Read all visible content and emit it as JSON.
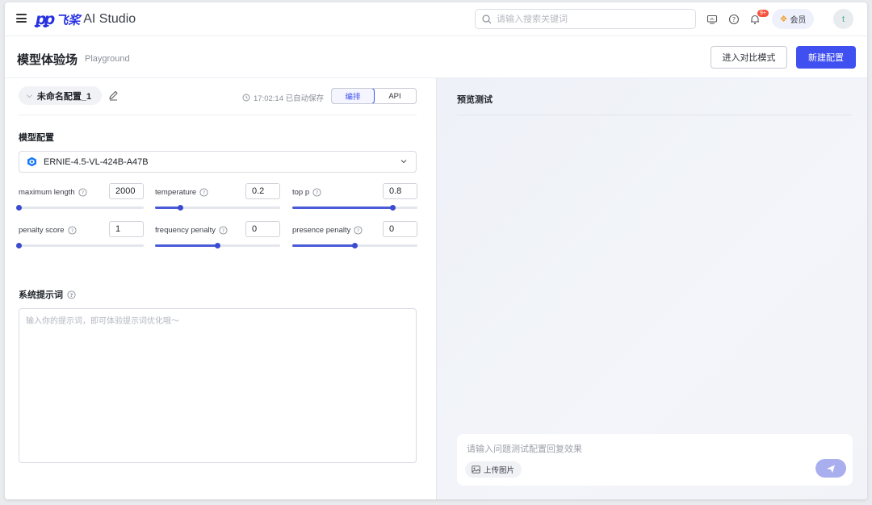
{
  "header": {
    "logo_mark": "ꝑꝑ",
    "logo_cn": "飞桨",
    "logo_en": "AI Studio",
    "search_placeholder": "请输入搜索关键词",
    "notification_badge": "9+",
    "vip_label": "会员",
    "avatar_letter": "t"
  },
  "titlebar": {
    "title": "模型体验场",
    "subtitle": "Playground",
    "compare_label": "进入对比模式",
    "new_label": "新建配置"
  },
  "config": {
    "name": "未命名配置_1",
    "saved_text": "17:02:14 已自动保存",
    "tabs": [
      "编排",
      "API"
    ],
    "active_tab": "编排"
  },
  "model_config": {
    "label": "模型配置",
    "selected_model": "ERNIE-4.5-VL-424B-A47B",
    "params": [
      {
        "label": "maximum length",
        "value": "2000",
        "level": 0.0
      },
      {
        "label": "temperature",
        "value": "0.2",
        "level": 0.2
      },
      {
        "label": "top p",
        "value": "0.8",
        "level": 0.8
      },
      {
        "label": "penalty score",
        "value": "1",
        "level": 0.0
      },
      {
        "label": "frequency penalty",
        "value": "0",
        "level": 0.5
      },
      {
        "label": "presence penalty",
        "value": "0",
        "level": 0.5
      }
    ]
  },
  "system_prompt": {
    "label": "系统提示词",
    "placeholder": "输入你的提示词，即可体验提示词优化哦～"
  },
  "preview": {
    "title": "预览测试",
    "input_placeholder": "请输入问题测试配置回复效果",
    "upload_label": "上传图片"
  },
  "colors": {
    "accent": "#4050f0",
    "brand": "#2932e1",
    "slider": "#4a5ad8"
  }
}
